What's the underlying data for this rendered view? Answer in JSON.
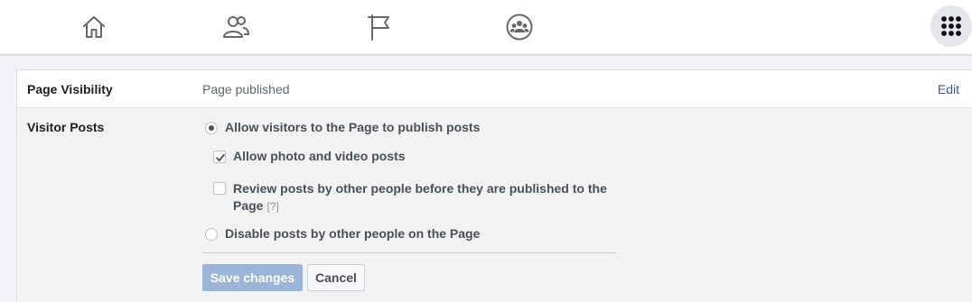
{
  "topbar": {
    "icons": [
      "home-icon",
      "friends-icon",
      "pages-flag-icon",
      "groups-icon"
    ],
    "menu_icon": "menu-grid-icon"
  },
  "settings": {
    "page_visibility": {
      "label": "Page Visibility",
      "value": "Page published",
      "edit_label": "Edit"
    },
    "visitor_posts": {
      "label": "Visitor Posts",
      "options": {
        "allow_visitors": {
          "label": "Allow visitors to the Page to publish posts",
          "selected": true
        },
        "allow_photo_video": {
          "label": "Allow photo and video posts",
          "checked": true
        },
        "review_posts": {
          "label_line1": "Review posts by other people before they are published to the",
          "label_line2": "Page",
          "help": "[?]",
          "checked": false
        },
        "disable_posts": {
          "label": "Disable posts by other people on the Page",
          "selected": false
        }
      },
      "save_label": "Save changes",
      "cancel_label": "Cancel"
    }
  },
  "colors": {
    "link": "#385898",
    "save_disabled": "#9cb4d8",
    "panel_bg": "#f2f2f2",
    "page_bg": "#f0f2f5"
  }
}
